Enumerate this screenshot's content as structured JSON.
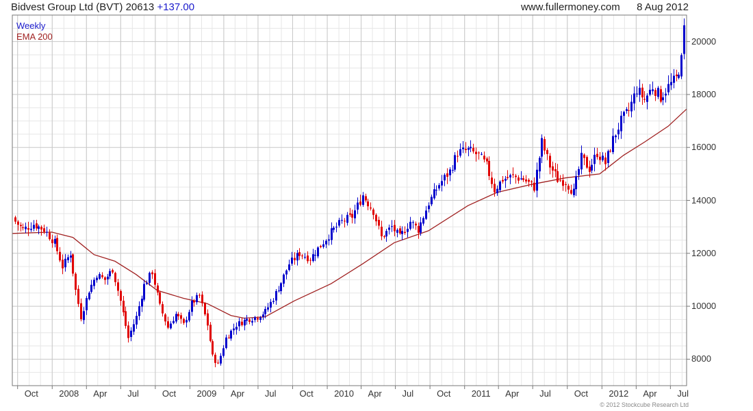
{
  "header": {
    "title": "Bidvest Group Ltd (BVT) 20613",
    "change": "+137.00",
    "source": "www.fullermoney.com",
    "date": "8 Aug 2012"
  },
  "legend": {
    "weekly": "Weekly",
    "ema": "EMA 200"
  },
  "footer": {
    "copyright": "© 2012 Stockcube Research Ltd"
  },
  "colors": {
    "up": "#0000cc",
    "down": "#e00000",
    "ema": "#a02020",
    "grid_major": "#c8c8c8",
    "grid_minor": "#e6e6e6",
    "title": "#222222",
    "change": "#1a1acc"
  },
  "chart_data": {
    "type": "candlestick",
    "frequency": "Weekly",
    "ylim": [
      7000,
      21000
    ],
    "y_ticks": [
      8000,
      10000,
      12000,
      14000,
      16000,
      18000,
      20000
    ],
    "y_tick_labels": [
      "8000",
      "10000",
      "12000",
      "14000",
      "16000",
      "18000",
      "20000"
    ],
    "x_range": [
      "2007-09-17",
      "2012-08-13"
    ],
    "x_ticks": [
      {
        "date": "2007-10-01",
        "label": "Oct"
      },
      {
        "date": "2008-01-01",
        "label": "2008"
      },
      {
        "date": "2008-04-01",
        "label": "Apr"
      },
      {
        "date": "2008-07-01",
        "label": "Jul"
      },
      {
        "date": "2008-10-01",
        "label": "Oct"
      },
      {
        "date": "2009-01-01",
        "label": "2009"
      },
      {
        "date": "2009-04-01",
        "label": "Apr"
      },
      {
        "date": "2009-07-01",
        "label": "Jul"
      },
      {
        "date": "2009-10-01",
        "label": "Oct"
      },
      {
        "date": "2010-01-01",
        "label": "2010"
      },
      {
        "date": "2010-04-01",
        "label": "Apr"
      },
      {
        "date": "2010-07-01",
        "label": "Jul"
      },
      {
        "date": "2010-10-01",
        "label": "Oct"
      },
      {
        "date": "2011-01-01",
        "label": "2011"
      },
      {
        "date": "2011-04-01",
        "label": "Apr"
      },
      {
        "date": "2011-07-01",
        "label": "Jul"
      },
      {
        "date": "2011-10-01",
        "label": "Oct"
      },
      {
        "date": "2012-01-01",
        "label": "2012"
      },
      {
        "date": "2012-04-01",
        "label": "Apr"
      },
      {
        "date": "2012-07-01",
        "label": "Jul"
      }
    ],
    "series": [
      {
        "name": "Weekly",
        "kind": "candles",
        "close_points": [
          [
            "2007-09-24",
            13200
          ],
          [
            "2007-10-15",
            12900
          ],
          [
            "2007-11-12",
            13100
          ],
          [
            "2007-12-10",
            12900
          ],
          [
            "2008-01-07",
            12400
          ],
          [
            "2008-01-28",
            11500
          ],
          [
            "2008-02-18",
            12000
          ],
          [
            "2008-03-03",
            10600
          ],
          [
            "2008-03-17",
            9600
          ],
          [
            "2008-04-07",
            10600
          ],
          [
            "2008-04-28",
            11200
          ],
          [
            "2008-05-19",
            11000
          ],
          [
            "2008-06-09",
            11400
          ],
          [
            "2008-06-30",
            10200
          ],
          [
            "2008-07-21",
            8800
          ],
          [
            "2008-08-11",
            9600
          ],
          [
            "2008-09-01",
            10800
          ],
          [
            "2008-09-22",
            11300
          ],
          [
            "2008-10-13",
            10000
          ],
          [
            "2008-11-03",
            9200
          ],
          [
            "2008-11-24",
            9700
          ],
          [
            "2008-12-15",
            9300
          ],
          [
            "2009-01-05",
            10100
          ],
          [
            "2009-01-26",
            10400
          ],
          [
            "2009-02-16",
            9300
          ],
          [
            "2009-03-02",
            8100
          ],
          [
            "2009-03-16",
            7800
          ],
          [
            "2009-04-06",
            8800
          ],
          [
            "2009-05-04",
            9300
          ],
          [
            "2009-06-01",
            9500
          ],
          [
            "2009-06-29",
            9600
          ],
          [
            "2009-07-20",
            9800
          ],
          [
            "2009-08-10",
            10300
          ],
          [
            "2009-08-31",
            10900
          ],
          [
            "2009-09-21",
            11600
          ],
          [
            "2009-10-19",
            12000
          ],
          [
            "2009-11-16",
            11800
          ],
          [
            "2009-12-14",
            12300
          ],
          [
            "2010-01-11",
            12800
          ],
          [
            "2010-02-08",
            13200
          ],
          [
            "2010-03-08",
            13400
          ],
          [
            "2010-04-05",
            14200
          ],
          [
            "2010-05-03",
            13600
          ],
          [
            "2010-05-24",
            12600
          ],
          [
            "2010-06-21",
            13000
          ],
          [
            "2010-07-12",
            12600
          ],
          [
            "2010-08-09",
            13200
          ],
          [
            "2010-08-30",
            12900
          ],
          [
            "2010-09-27",
            13900
          ],
          [
            "2010-10-25",
            14600
          ],
          [
            "2010-11-22",
            15100
          ],
          [
            "2010-12-13",
            15800
          ],
          [
            "2011-01-10",
            15900
          ],
          [
            "2011-02-07",
            15700
          ],
          [
            "2011-02-28",
            15300
          ],
          [
            "2011-03-21",
            14400
          ],
          [
            "2011-04-11",
            14800
          ],
          [
            "2011-05-09",
            14900
          ],
          [
            "2011-06-06",
            14800
          ],
          [
            "2011-07-04",
            14500
          ],
          [
            "2011-07-25",
            16200
          ],
          [
            "2011-08-15",
            15300
          ],
          [
            "2011-09-05",
            14800
          ],
          [
            "2011-09-26",
            14700
          ],
          [
            "2011-10-17",
            14300
          ],
          [
            "2011-11-07",
            15600
          ],
          [
            "2011-11-28",
            15200
          ],
          [
            "2011-12-19",
            15800
          ],
          [
            "2012-01-09",
            15400
          ],
          [
            "2012-01-30",
            16300
          ],
          [
            "2012-02-20",
            17000
          ],
          [
            "2012-03-12",
            17400
          ],
          [
            "2012-04-02",
            18200
          ],
          [
            "2012-04-23",
            17800
          ],
          [
            "2012-05-14",
            18300
          ],
          [
            "2012-06-04",
            17900
          ],
          [
            "2012-06-25",
            18300
          ],
          [
            "2012-07-16",
            18600
          ],
          [
            "2012-07-30",
            19300
          ],
          [
            "2012-08-06",
            20613
          ]
        ]
      },
      {
        "name": "EMA 200",
        "kind": "line",
        "points": [
          [
            "2007-09-17",
            12750
          ],
          [
            "2007-12-31",
            12800
          ],
          [
            "2008-02-25",
            12600
          ],
          [
            "2008-04-21",
            11950
          ],
          [
            "2008-06-16",
            11700
          ],
          [
            "2008-08-11",
            11200
          ],
          [
            "2008-10-06",
            10600
          ],
          [
            "2008-12-15",
            10300
          ],
          [
            "2009-02-16",
            10100
          ],
          [
            "2009-04-20",
            9650
          ],
          [
            "2009-05-25",
            9550
          ],
          [
            "2009-07-20",
            9600
          ],
          [
            "2009-10-05",
            10200
          ],
          [
            "2010-01-11",
            10850
          ],
          [
            "2010-04-05",
            11600
          ],
          [
            "2010-06-28",
            12400
          ],
          [
            "2010-09-27",
            12850
          ],
          [
            "2011-01-10",
            13800
          ],
          [
            "2011-03-28",
            14300
          ],
          [
            "2011-06-27",
            14600
          ],
          [
            "2011-09-26",
            14850
          ],
          [
            "2011-12-26",
            15000
          ],
          [
            "2012-02-27",
            15700
          ],
          [
            "2012-04-23",
            16200
          ],
          [
            "2012-06-25",
            16800
          ],
          [
            "2012-08-13",
            17450
          ]
        ]
      }
    ],
    "y_axis_position": "right",
    "grid": true
  }
}
